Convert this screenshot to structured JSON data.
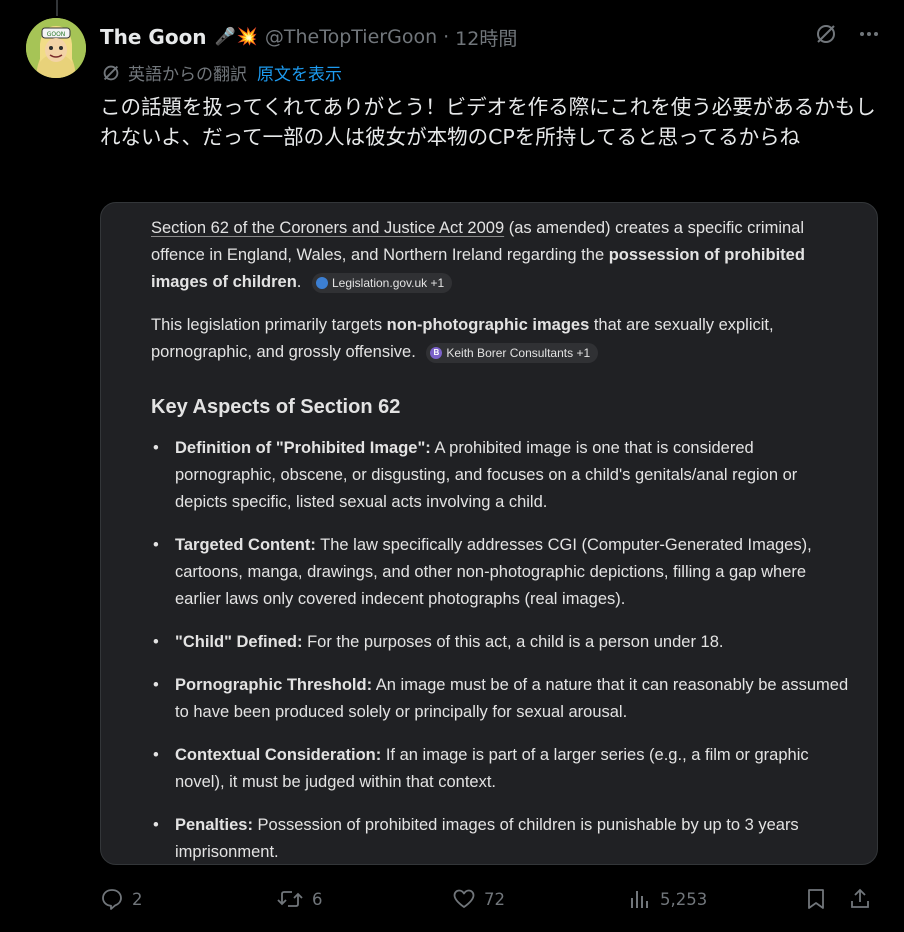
{
  "user": {
    "name": "The Goon",
    "emoji": "🎤💥",
    "handle": "@TheTopTierGoon",
    "separator": "·",
    "time": "12時間"
  },
  "translation": {
    "label": "英語からの翻訳",
    "show_original": "原文を表示"
  },
  "tweet_text": "この話題を扱ってくれてありがとう！ビデオを作る際にこれを使う必要があるかもしれないよ、だって一部の人は彼女が本物のCPを所持してると思ってるからね",
  "card": {
    "p1_link": "Section 62 of the Coroners and Justice Act 2009",
    "p1_text": " (as amended) creates a specific criminal offence in England, Wales, and Northern Ireland regarding the ",
    "p1_bold": "possession of prohibited images of children",
    "p1_end": ".",
    "chip1": "Legislation.gov.uk +1",
    "p2_text": "This legislation primarily targets ",
    "p2_bold": "non-photographic images",
    "p2_end": " that are sexually explicit, pornographic, and grossly offensive.",
    "chip2": "Keith Borer Consultants +1",
    "chip2_icon_letter": "B",
    "heading": "Key Aspects of Section 62",
    "bullets": [
      {
        "term": "Definition of \"Prohibited Image\":",
        "text": " A prohibited image is one that is considered pornographic, obscene, or disgusting, and focuses on a child's genitals/anal region or depicts specific, listed sexual acts involving a child."
      },
      {
        "term": "Targeted Content:",
        "text": " The law specifically addresses CGI (Computer-Generated Images), cartoons, manga, drawings, and other non-photographic depictions, filling a gap where earlier laws only covered indecent photographs (real images)."
      },
      {
        "term": "\"Child\" Defined:",
        "text": " For the purposes of this act, a child is a person under 18."
      },
      {
        "term": "Pornographic Threshold:",
        "text": " An image must be of a nature that it can reasonably be assumed to have been produced solely or principally for sexual arousal."
      },
      {
        "term": "Contextual Consideration:",
        "text": " If an image is part of a larger series (e.g., a film or graphic novel), it must be judged within that context."
      },
      {
        "term": "Penalties:",
        "text": " Possession of prohibited images of children is punishable by up to 3 years imprisonment."
      }
    ]
  },
  "actions": {
    "replies": "2",
    "reposts": "6",
    "likes": "72",
    "views": "5,253"
  },
  "colors": {
    "background": "#000000",
    "text": "#e7e9ea",
    "muted": "#71767b",
    "link": "#1d9bf0",
    "card_bg": "#202124"
  }
}
